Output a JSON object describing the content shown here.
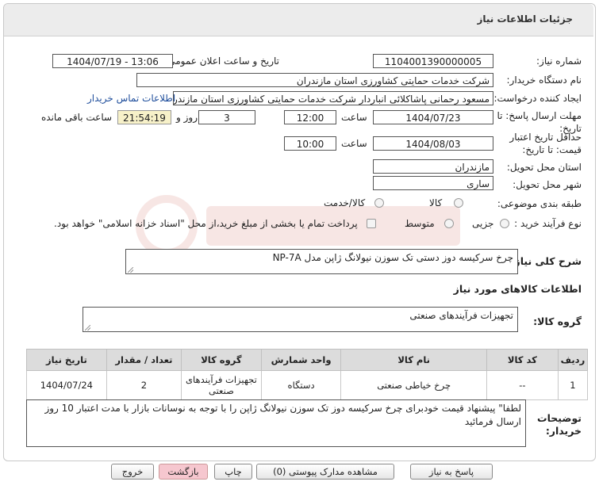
{
  "header": {
    "title": "جزئیات اطلاعات نیاز"
  },
  "fields": {
    "need_number_label": "شماره نیاز:",
    "need_number": "1104001390000005",
    "announce_label": "تاریخ و ساعت اعلان عمومی:",
    "announce_value": "1404/07/19 - 13:06",
    "buyer_label": "نام دستگاه خریدار:",
    "buyer_value": "شرکت خدمات حمایتی کشاورزی استان مازندران",
    "creator_label": "ایجاد کننده درخواست:",
    "creator_value": "مسعود رحمانی پاشاکلائی انباردار شرکت خدمات حمایتی کشاورزی استان مازندران",
    "contact_link": "اطلاعات تماس خریدار",
    "deadline_label": "مهلت ارسال پاسخ: تا تاریخ:",
    "deadline_date": "1404/07/23",
    "time_label": "ساعت",
    "deadline_time": "12:00",
    "days_value": "3",
    "days_label": "روز و",
    "remaining_value": "21:54:19",
    "remaining_label": "ساعت باقی مانده",
    "validity_label": "حداقل تاریخ اعتبار قیمت: تا تاریخ:",
    "validity_date": "1404/08/03",
    "validity_time": "10:00",
    "province_label": "استان محل تحویل:",
    "province_value": "مازندران",
    "city_label": "شهر محل تحویل:",
    "city_value": "ساری",
    "category_label": "طبقه بندی موضوعی:",
    "category_options": [
      "کالا",
      "کالا/خدمت"
    ],
    "process_label": "نوع فرآیند خرید :",
    "process_options": [
      "جزیی",
      "متوسط"
    ],
    "payment_note": "پرداخت تمام یا بخشی از مبلغ خرید،از محل \"اسناد خزانه اسلامی\" خواهد بود."
  },
  "summary": {
    "label": "شرح کلی نیاز:",
    "value": "چرخ سرکیسه دوز دستی تک سوزن نیولانگ ژاپن مدل NP-7A"
  },
  "goods_section": {
    "title": "اطلاعات کالاهای مورد نیاز",
    "group_label": "گروه کالا:",
    "group_value": "تجهیزات فرآیندهای صنعتی"
  },
  "table": {
    "headers": [
      "ردیف",
      "کد کالا",
      "نام کالا",
      "واحد شمارش",
      "گروه کالا",
      "تعداد / مقدار",
      "تاریخ نیاز"
    ],
    "rows": [
      [
        "1",
        "--",
        "چرخ خیاطی صنعتی",
        "دستگاه",
        "تجهیزات فرآیندهای صنعتی",
        "2",
        "1404/07/24"
      ]
    ]
  },
  "buyer_notes": {
    "label": "توضیحات خریدار:",
    "value": "لطفا\" پیشنهاد قیمت خودبرای چرخ سرکیسه دوز تک سوزن نیولانگ ژاپن  را با توجه به نوسانات بازار با مدت اعتبار 10 روز ارسال فرمائید"
  },
  "buttons": {
    "reply": "پاسخ به نیاز",
    "attachments": "مشاهده مدارک پیوستی (0)",
    "print": "چاپ",
    "back": "بازگشت",
    "exit": "خروج"
  },
  "colors": {
    "header_bg": "#ececec",
    "remaining_bg": "#f7f1c9",
    "link": "#1f4e9c",
    "pink_button": "#f6c7cf"
  }
}
